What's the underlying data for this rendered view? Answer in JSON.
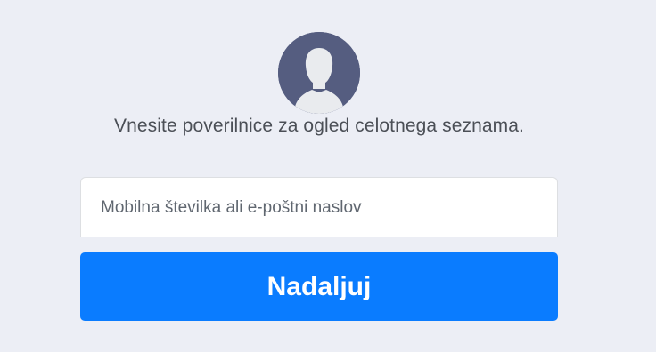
{
  "prompt": {
    "text": "Vnesite poverilnice za ogled celotnega seznama."
  },
  "login_input": {
    "placeholder": "Mobilna številka ali e-poštni naslov",
    "value": ""
  },
  "continue_button": {
    "label": "Nadaljuj"
  },
  "avatar": {
    "icon": "default-user-avatar-icon"
  },
  "colors": {
    "background": "#eceef5",
    "avatar_background": "#555d80",
    "avatar_silhouette": "#e9ebee",
    "button": "#0a7cff",
    "button_text": "#ffffff",
    "prompt_text": "#4b4f56",
    "placeholder_text": "#606770"
  }
}
